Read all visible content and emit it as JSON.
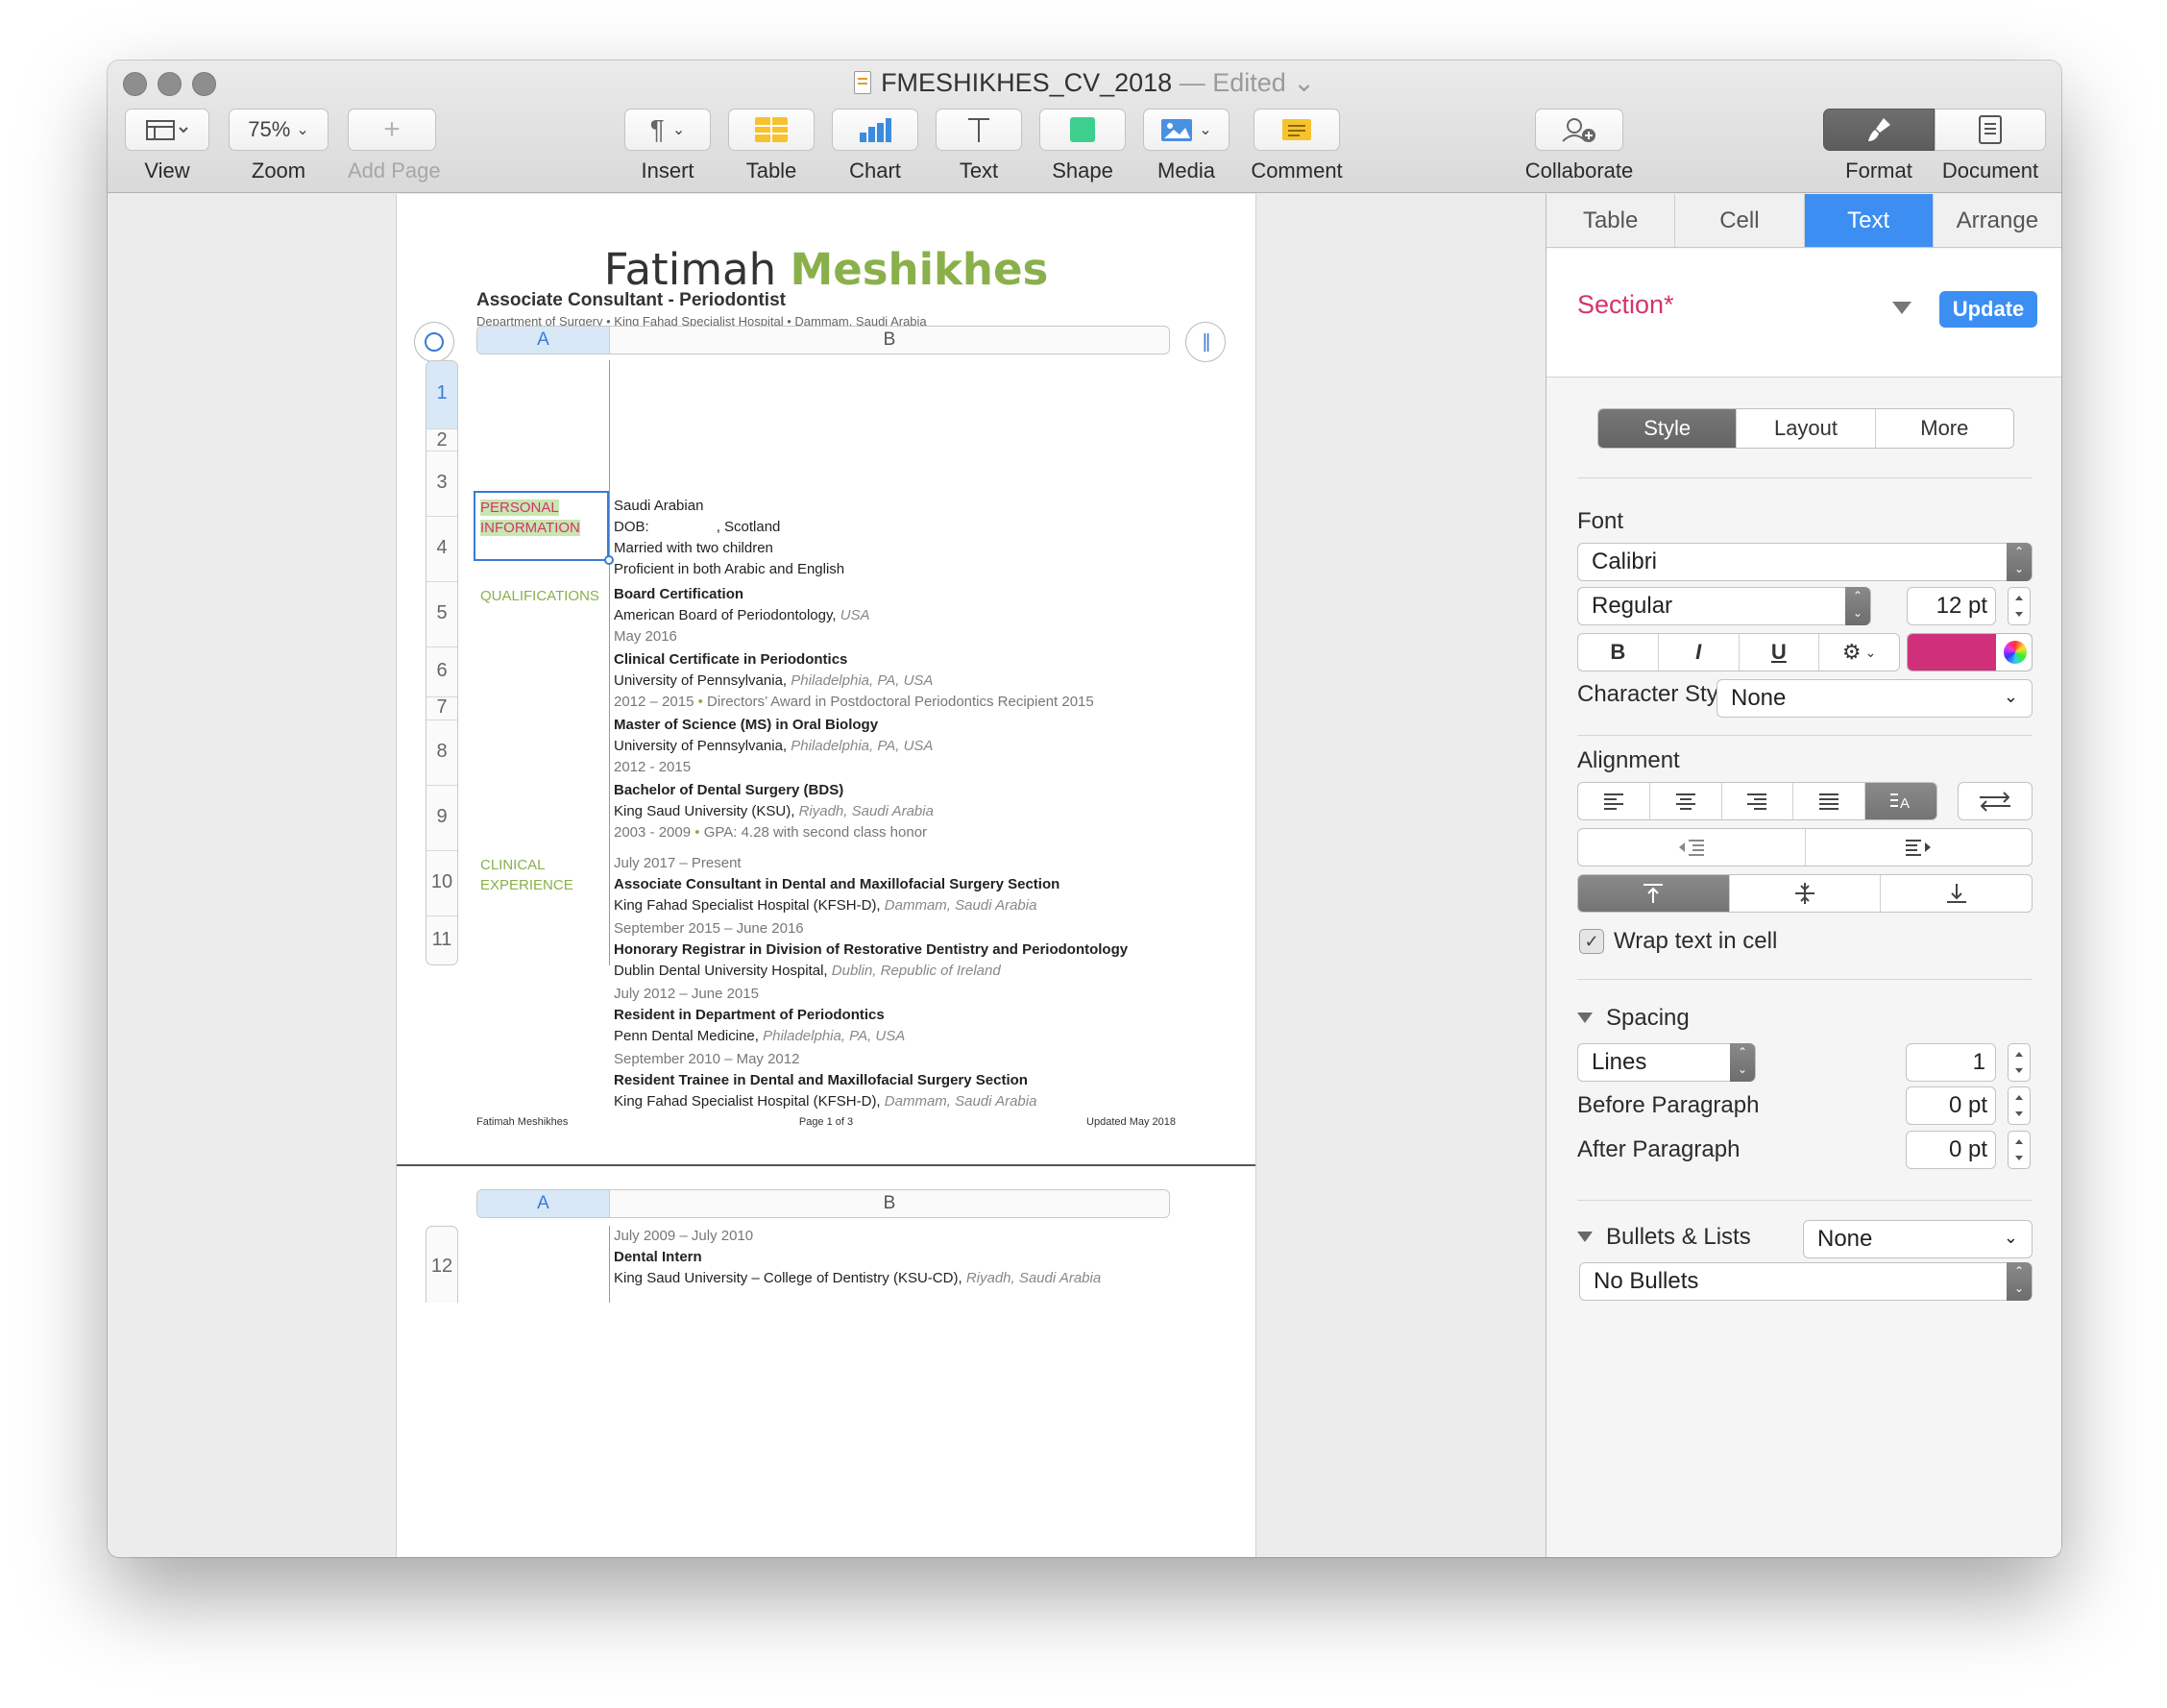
{
  "window": {
    "title": "FMESHIKHES_CV_2018",
    "status": "— Edited",
    "status_chevron": "⌄"
  },
  "toolbar": {
    "view_label": "View",
    "zoom_value": "75%",
    "zoom_label": "Zoom",
    "add_page_label": "Add Page",
    "insert_label": "Insert",
    "table_label": "Table",
    "chart_label": "Chart",
    "text_label": "Text",
    "shape_label": "Shape",
    "media_label": "Media",
    "comment_label": "Comment",
    "collaborate_label": "Collaborate",
    "format_label": "Format",
    "document_label": "Document"
  },
  "document": {
    "first_name": "Fatimah",
    "last_name": "Meshikhes",
    "job_title": "Associate Consultant - Periodontist",
    "dept_line": "Department of Surgery • King Fahad Specialist Hospital • Dammam, Saudi Arabia",
    "col_a": "A",
    "col_b": "B",
    "rows": [
      "1",
      "2",
      "3",
      "4",
      "5",
      "6",
      "7",
      "8",
      "9",
      "10",
      "11"
    ],
    "sections": {
      "personal_1": "PERSONAL",
      "personal_2": "INFORMATION",
      "qualifications": "QUALIFICATIONS",
      "clinical_1": "CLINICAL",
      "clinical_2": "EXPERIENCE"
    },
    "personal": {
      "line1": "Saudi Arabian",
      "dob_label": "DOB:",
      "dob_place": ", Scotland",
      "line3": "Married with two children",
      "line4": "Proficient in both Arabic and English"
    },
    "q1": {
      "title": "Board Certification",
      "org": "American Board of Periodontology,",
      "loc": "USA",
      "date": "May 2016"
    },
    "q2": {
      "title": "Clinical Certificate in Periodontics",
      "org": "University of Pennsylvania,",
      "loc": "Philadelphia, PA, USA",
      "date": "2012 – 2015",
      "extra": "Directors’ Award in Postdoctoral Periodontics Recipient 2015"
    },
    "q3": {
      "title": "Master of Science (MS) in Oral Biology",
      "org": "University of Pennsylvania,",
      "loc": "Philadelphia, PA, USA",
      "date": "2012 - 2015"
    },
    "q4": {
      "title": "Bachelor of Dental Surgery (BDS)",
      "org": "King Saud University (KSU),",
      "loc": "Riyadh, Saudi Arabia",
      "date": "2003 - 2009",
      "extra": "GPA: 4.28 with second class honor"
    },
    "e1": {
      "date": "July 2017 – Present",
      "title": "Associate Consultant in Dental and Maxillofacial Surgery Section",
      "org": "King Fahad Specialist Hospital (KFSH-D),",
      "loc": "Dammam, Saudi Arabia"
    },
    "e2": {
      "date": "September 2015 – June 2016",
      "title": "Honorary Registrar in Division of Restorative Dentistry and Periodontology",
      "org": "Dublin Dental University Hospital,",
      "loc": "Dublin, Republic of Ireland"
    },
    "e3": {
      "date": "July 2012 – June 2015",
      "title": "Resident in Department of Periodontics",
      "org": "Penn Dental Medicine,",
      "loc": "Philadelphia, PA, USA"
    },
    "e4": {
      "date": "September 2010 – May 2012",
      "title": "Resident Trainee in Dental and Maxillofacial Surgery Section",
      "org": "King Fahad Specialist Hospital (KFSH-D),",
      "loc": "Dammam, Saudi Arabia"
    },
    "footer": {
      "left": "Fatimah Meshikhes",
      "center": "Page 1 of 3",
      "right": "Updated May 2018"
    },
    "page2": {
      "col_a": "A",
      "col_b": "B",
      "row": "12",
      "e5": {
        "date": "July 2009 – July 2010",
        "title": "Dental Intern",
        "org": "King Saud University – College of Dentistry (KSU-CD),",
        "loc": "Riyadh, Saudi Arabia"
      }
    }
  },
  "inspector": {
    "tabs": [
      "Table",
      "Cell",
      "Text",
      "Arrange"
    ],
    "active_tab": "Text",
    "paragraph_style": "Section*",
    "update_label": "Update",
    "subtabs": [
      "Style",
      "Layout",
      "More"
    ],
    "font_label": "Font",
    "font_family": "Calibri",
    "font_typeface": "Regular",
    "font_size": "12 pt",
    "bold": "B",
    "italic": "I",
    "underline": "U",
    "text_color": "#d0307a",
    "char_styles_label": "Character Styles",
    "char_styles_value": "None",
    "alignment_label": "Alignment",
    "wrap_label": "Wrap text in cell",
    "wrap_checked": true,
    "spacing_label": "Spacing",
    "spacing_mode": "Lines",
    "spacing_value": "1",
    "before_label": "Before Paragraph",
    "before_value": "0 pt",
    "after_label": "After Paragraph",
    "after_value": "0 pt",
    "bullets_label": "Bullets & Lists",
    "bullets_value": "None",
    "bullets_style": "No Bullets"
  }
}
